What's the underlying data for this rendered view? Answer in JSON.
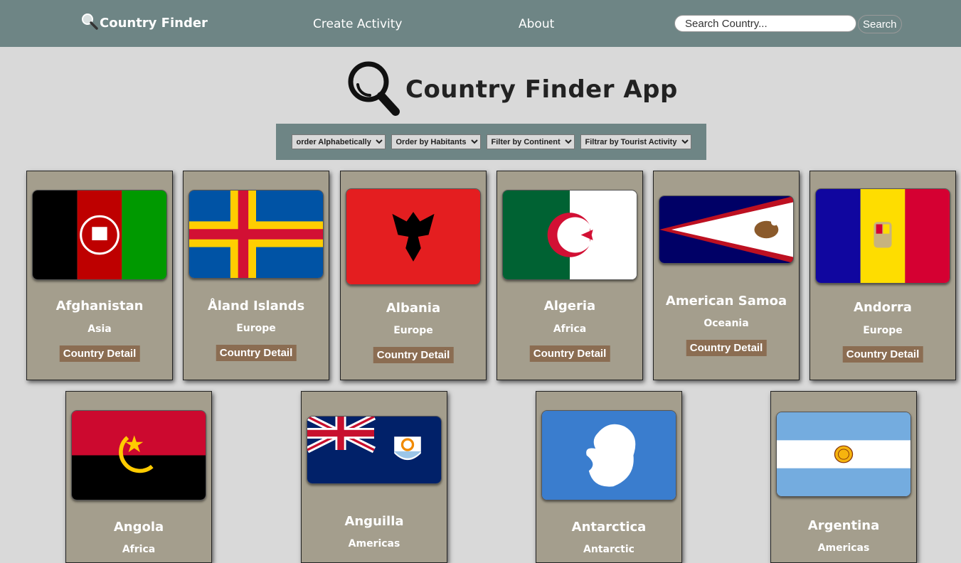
{
  "navbar": {
    "brand": "Country Finder",
    "links": [
      "Create Activity",
      "About"
    ],
    "search_placeholder": "Search Country...",
    "search_button": "Search"
  },
  "hero": {
    "title": "Country Finder App"
  },
  "filters": [
    "order Alphabetically",
    "Order by Habitants",
    "Filter by Continent",
    "Filtrar by Tourist Activity"
  ],
  "detail_label": "Country Detail",
  "countries": [
    {
      "name": "Afghanistan",
      "continent": "Asia"
    },
    {
      "name": "Åland Islands",
      "continent": "Europe"
    },
    {
      "name": "Albania",
      "continent": "Europe"
    },
    {
      "name": "Algeria",
      "continent": "Africa"
    },
    {
      "name": "American Samoa",
      "continent": "Oceania"
    },
    {
      "name": "Andorra",
      "continent": "Europe"
    },
    {
      "name": "Angola",
      "continent": "Africa"
    },
    {
      "name": "Anguilla",
      "continent": "Americas"
    },
    {
      "name": "Antarctica",
      "continent": "Antarctic"
    },
    {
      "name": "Argentina",
      "continent": "Americas"
    }
  ],
  "colors": {
    "navbar": "#6e8585",
    "background": "#d9d9d9",
    "card": "#a49e8d",
    "detail_button": "#8b6d52"
  }
}
